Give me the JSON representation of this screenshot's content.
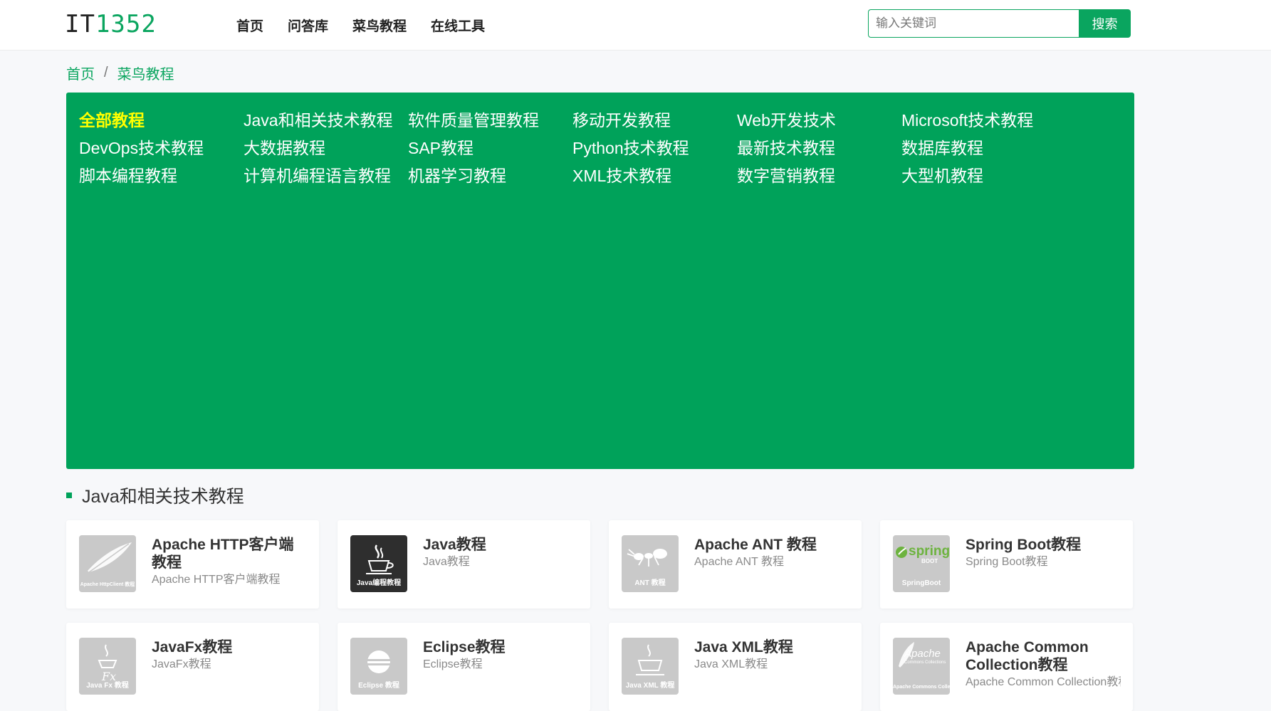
{
  "header": {
    "logo_text": "IT",
    "logo_num": "1352",
    "nav": [
      "首页",
      "问答库",
      "菜鸟教程",
      "在线工具"
    ],
    "search_placeholder": "输入关键词",
    "search_button": "搜索"
  },
  "breadcrumb": {
    "home": "首页",
    "separator": "/",
    "current": "菜鸟教程"
  },
  "categories": [
    "全部教程",
    "Java和相关技术教程",
    "软件质量管理教程",
    "移动开发教程",
    "Web开发技术",
    "Microsoft技术教程",
    "DevOps技术教程",
    "大数据教程",
    "SAP教程",
    "Python技术教程",
    "最新技术教程",
    "数据库教程",
    "脚本编程教程",
    "计算机编程语言教程",
    "机器学习教程",
    "XML技术教程",
    "数字营销教程",
    "大型机教程"
  ],
  "active_category_index": 0,
  "section": {
    "title": "Java和相关技术教程"
  },
  "cards": [
    {
      "title": "Apache HTTP客户端教程",
      "subtitle": "Apache HTTP客户端教程",
      "thumb_caption": "Apache HttpClient 教程",
      "icon": "feather-icon"
    },
    {
      "title": "Java教程",
      "subtitle": "Java教程",
      "thumb_caption": "Java编程教程",
      "icon": "java-cup-icon"
    },
    {
      "title": "Apache ANT 教程",
      "subtitle": "Apache ANT 教程",
      "thumb_caption": "ANT 教程",
      "icon": "ant-icon"
    },
    {
      "title": "Spring Boot教程",
      "subtitle": "Spring Boot教程",
      "thumb_caption": "SpringBoot",
      "thumb_logo": "spring",
      "thumb_logo_sub": "BOOT",
      "icon": "spring-leaf-icon"
    },
    {
      "title": "JavaFx教程",
      "subtitle": "JavaFx教程",
      "thumb_caption": "Java Fx 教程",
      "icon": "javafx-icon"
    },
    {
      "title": "Eclipse教程",
      "subtitle": "Eclipse教程",
      "thumb_caption": "Eclipse 教程",
      "icon": "eclipse-icon"
    },
    {
      "title": "Java XML教程",
      "subtitle": "Java XML教程",
      "thumb_caption": "Java XML 教程",
      "icon": "java-xml-icon"
    },
    {
      "title": "Apache Common Collection教程",
      "subtitle": "Apache Common Collection教程",
      "thumb_caption": "Apache Commons Collections 教程",
      "thumb_logo": "Apache",
      "thumb_logo_sub": "Commons Collections",
      "icon": "apache-feather-icon"
    }
  ],
  "colors": {
    "primary": "#00a25a",
    "active_category": "#ffff00"
  }
}
